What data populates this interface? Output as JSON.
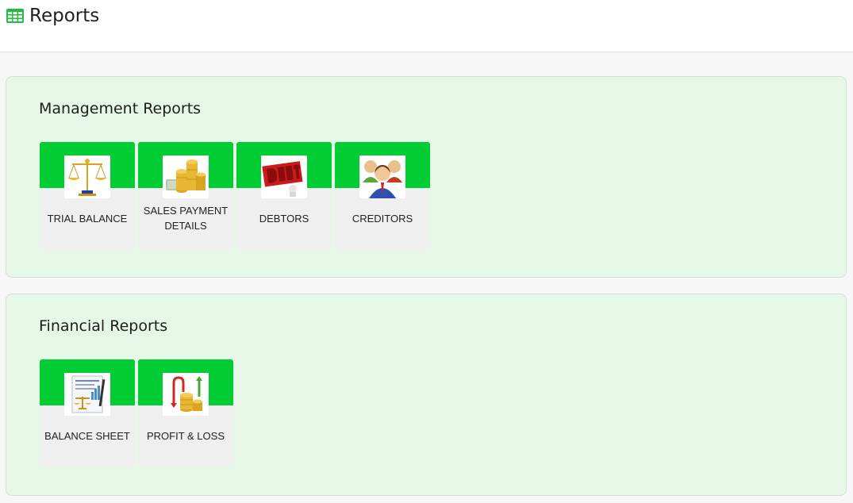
{
  "header": {
    "title": "Reports",
    "icon": "table-icon",
    "icon_color": "#22bb44"
  },
  "sections": [
    {
      "heading": "Management Reports",
      "tiles": [
        {
          "label": "TRIAL BALANCE",
          "icon": "scales-icon"
        },
        {
          "label": "SALES PAYMENT DETAILS",
          "icon": "coins-icon"
        },
        {
          "label": "DEBTORS",
          "icon": "debt-icon"
        },
        {
          "label": "CREDITORS",
          "icon": "people-icon"
        }
      ]
    },
    {
      "heading": "Financial Reports",
      "tiles": [
        {
          "label": "BALANCE SHEET",
          "icon": "balance-sheet-icon"
        },
        {
          "label": "PROFIT & LOSS",
          "icon": "profit-loss-icon"
        }
      ]
    }
  ],
  "colors": {
    "tile_band": "#00cc33",
    "panel_bg": "#e7f7e7",
    "tile_bg": "#efefef"
  }
}
